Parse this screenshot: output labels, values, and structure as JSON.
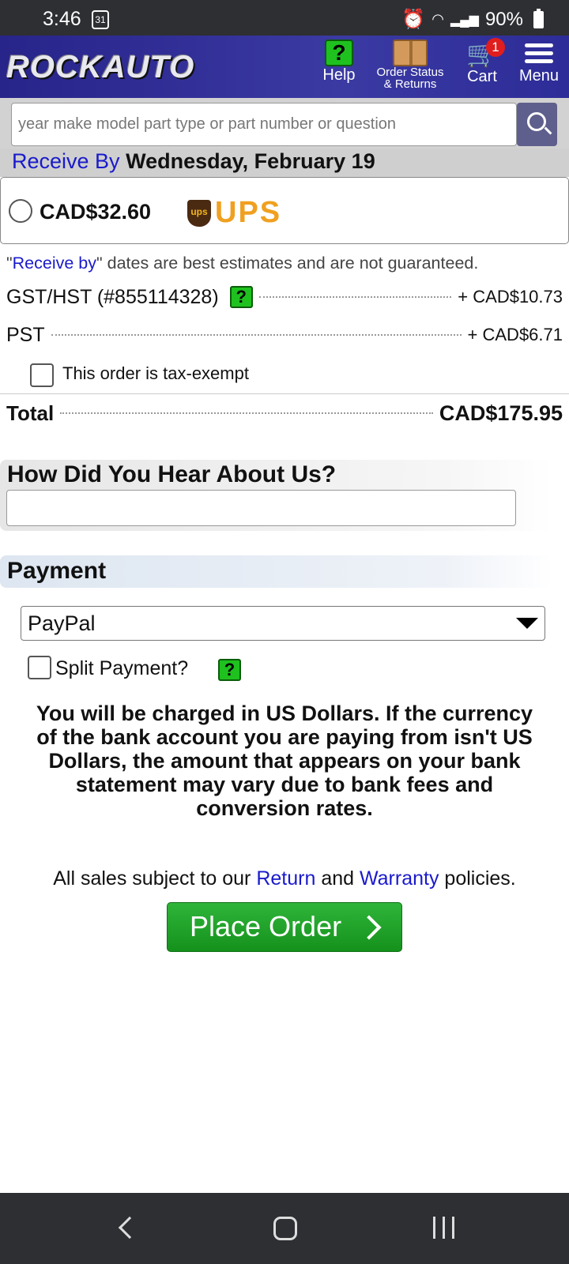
{
  "status_bar": {
    "time": "3:46",
    "calendar_day": "31",
    "battery": "90%"
  },
  "header": {
    "logo": "ROCKAUTO",
    "help_label": "Help",
    "order_status_label_1": "Order Status",
    "order_status_label_2": "& Returns",
    "cart_label": "Cart",
    "cart_count": "1",
    "menu_label": "Menu"
  },
  "search": {
    "placeholder": "year make model part type or part number or question"
  },
  "shipping": {
    "receive_by_label": "Receive By",
    "receive_date": "Wednesday, February 19",
    "price": "CAD$32.60",
    "carrier": "UPS",
    "carrier_badge": "ups"
  },
  "disclaimer": {
    "quote_open": "\"",
    "link": "Receive by",
    "rest": "\" dates are best estimates and are not guaranteed."
  },
  "taxes": {
    "gst_label": "GST/HST (#855114328)",
    "gst_amount": "+ CAD$10.73",
    "pst_label": "PST",
    "pst_amount": "+ CAD$6.71",
    "tax_exempt_label": "This order is tax-exempt"
  },
  "total": {
    "label": "Total",
    "amount": "CAD$175.95"
  },
  "how_heard": {
    "title": "How Did You Hear About Us?",
    "value": ""
  },
  "payment": {
    "title": "Payment",
    "selected_method": "PayPal",
    "split_label": "Split Payment?",
    "currency_warning": "You will be charged in US Dollars. If the currency of the bank account you are paying from isn't US Dollars, the amount that appears on your bank statement may vary due to bank fees and conversion rates."
  },
  "policies": {
    "prefix": "All sales subject to our ",
    "return_link": "Return",
    "middle": " and ",
    "warranty_link": "Warranty",
    "suffix": " policies."
  },
  "place_order_label": "Place Order",
  "help_glyph": "?"
}
